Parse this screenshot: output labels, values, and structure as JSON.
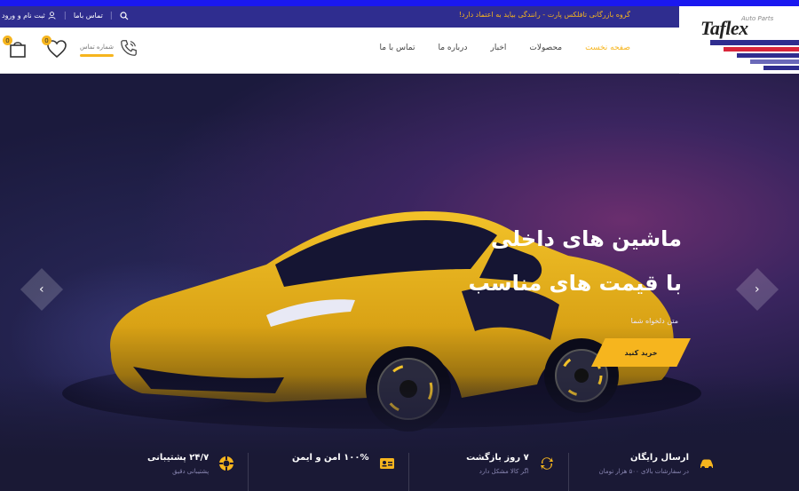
{
  "colors": {
    "brand_blue": "#2f2d8f",
    "accent": "#f6b51e",
    "hero_bg": "#171633"
  },
  "topbar": {
    "slogan": "گروه بازرگانی تافلکس پارت - رانندگی بیاید به اعتماد دارد!",
    "contact_link": "تماس باما",
    "login_link": "ثبت نام و ورود"
  },
  "logo": {
    "text": "Taflex",
    "sub": "Auto Parts"
  },
  "nav": {
    "items": [
      {
        "label": "صفحه نخست",
        "active": true
      },
      {
        "label": "محصولات",
        "active": false
      },
      {
        "label": "اخبار",
        "active": false
      },
      {
        "label": "درباره ما",
        "active": false
      },
      {
        "label": "تماس با ما",
        "active": false
      }
    ]
  },
  "header": {
    "phone_label": "شماره تماس",
    "wishlist_count": "0",
    "cart_count": "0"
  },
  "hero": {
    "title_line1": "ماشین های داخلی",
    "title_line2": "با قیمت های مناسب",
    "subtitle": "متن دلخواه شما",
    "cta": "خرید کنید"
  },
  "features": [
    {
      "icon": "car-icon",
      "title": "ارسال رایگان",
      "sub": "در سفارشات بالای ۵۰۰ هزار تومان"
    },
    {
      "icon": "refresh-icon",
      "title": "۷ روز بازگشت",
      "sub": "اگر کالا مشکل دارد"
    },
    {
      "icon": "id-card-icon",
      "title": "۱۰۰% امن و ایمن",
      "sub": ""
    },
    {
      "icon": "lifebuoy-icon",
      "title": "۲۴/۷ پشتیبانی",
      "sub": "پشتیبانی دقیق"
    }
  ]
}
